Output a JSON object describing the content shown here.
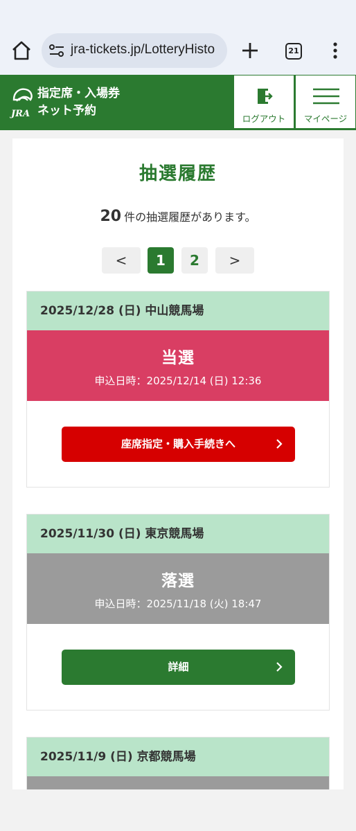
{
  "browser": {
    "url": "jra-tickets.jp/LotteryHisto",
    "tab_count": "21"
  },
  "header": {
    "title_line1": "指定席・入場券",
    "title_line2": "ネット予約",
    "logo_text": "JRA",
    "logout_label": "ログアウト",
    "mypage_label": "マイページ"
  },
  "main": {
    "heading": "抽選履歴",
    "count_number": "20",
    "count_suffix": "件の抽選履歴があります。"
  },
  "pagination": {
    "prev": "<",
    "pages": [
      "1",
      "2"
    ],
    "current": "1",
    "next": ">"
  },
  "entries": [
    {
      "title": "2025/12/28 (日) 中山競馬場",
      "status": "当選",
      "applied_label": "申込日時：",
      "applied_at": "2025/12/14 (日) 12:36",
      "action_label": "座席指定・購入手続きへ"
    },
    {
      "title": "2025/11/30 (日) 東京競馬場",
      "status": "落選",
      "applied_label": "申込日時：",
      "applied_at": "2025/11/18 (火) 18:47",
      "action_label": "詳細"
    },
    {
      "title": "2025/11/9 (日) 京都競馬場"
    }
  ],
  "colors": {
    "brand_green": "#2b7a30",
    "entry_header": "#b9e4c9",
    "won": "#d93e63",
    "lost": "#9b9b9b",
    "action_red": "#d60000"
  }
}
